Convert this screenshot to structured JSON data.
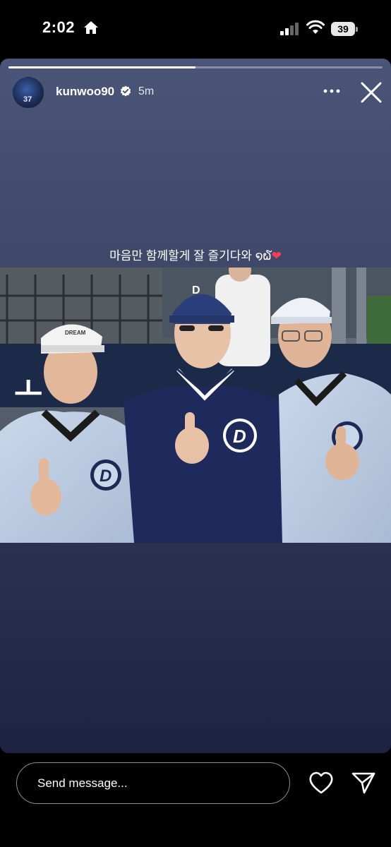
{
  "status_bar": {
    "time": "2:02",
    "battery": "39"
  },
  "story": {
    "progress": 0.5,
    "username": "kunwoo90",
    "avatar_text": "37",
    "time_ago": "5m",
    "caption_text": "마음만 함께할게 잘 즐기다와 ",
    "caption_emoji": "໑໖",
    "caption_heart": "❤"
  },
  "photo": {
    "cap_left_text": "DREAM",
    "cap_middle_letter": "D",
    "logo_letter": "D"
  },
  "reply_bar": {
    "placeholder": "Send message..."
  },
  "icons": {
    "home": "home-icon",
    "signal": "signal-icon",
    "wifi": "wifi-icon",
    "battery": "battery-icon",
    "verified": "verified-badge-icon",
    "more": "more-options-icon",
    "close": "close-icon",
    "like": "heart-icon",
    "send": "send-icon"
  }
}
